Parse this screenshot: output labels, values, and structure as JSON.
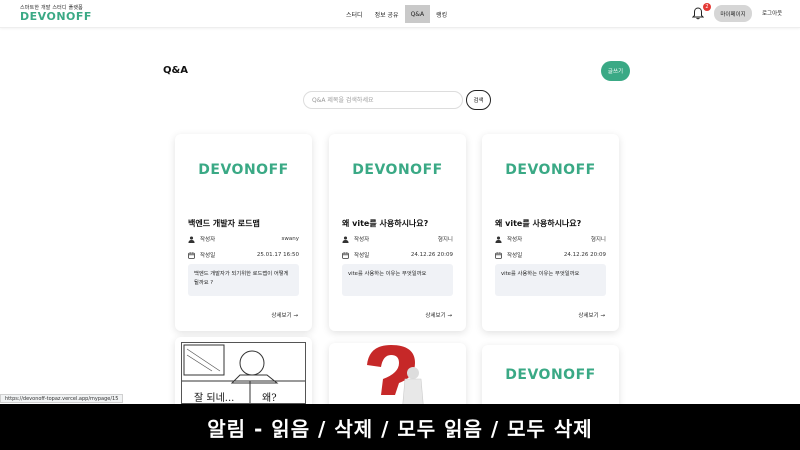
{
  "header": {
    "tagline": "스마트한 개발 스터디 플랫폼",
    "logo": "DEVONOFF",
    "nav": [
      {
        "label": "스터디",
        "active": false
      },
      {
        "label": "정보 공유",
        "active": false
      },
      {
        "label": "Q&A",
        "active": true
      },
      {
        "label": "랭킹",
        "active": false
      }
    ],
    "notification_count": "2",
    "mypage_label": "마이페이지",
    "logout_label": "로그아웃"
  },
  "main": {
    "title": "Q&A",
    "write_label": "글쓰기",
    "search_placeholder": "Q&A 제목을 검색하세요",
    "search_button": "검색"
  },
  "cards": [
    {
      "logo": "DEVONOFF",
      "title": "백엔드 개발자 로드맵",
      "author_label": "작성자",
      "author": "swany",
      "date_label": "작성일",
      "date": "25.01.17 16:50",
      "body": "백엔드 개발자가 되기위한 로드맵이 어떻게 될까요 ?",
      "more": "상세보기 →"
    },
    {
      "logo": "DEVONOFF",
      "title": "왜 vite를 사용하시나요?",
      "author_label": "작성자",
      "author": "형지니",
      "date_label": "작성일",
      "date": "24.12.26 20:09",
      "body": "vite를 사용하는 이유는 무엇일까요",
      "more": "상세보기 →"
    },
    {
      "logo": "DEVONOFF",
      "title": "왜 vite를 사용하시나요?",
      "author_label": "작성자",
      "author": "형지니",
      "date_label": "작성일",
      "date": "24.12.26 20:09",
      "body": "vite를 사용하는 이유는 무엇일까요",
      "more": "상세보기 →"
    }
  ],
  "row2": {
    "meme_text_1": "잘 되네...",
    "meme_text_2": "왜?",
    "logo": "DEVONOFF"
  },
  "status_url": "https://devonoff-topaz.vercel.app/mypage/15",
  "caption": "알림 - 읽음 / 삭제 / 모두 읽음 / 모두 삭제",
  "colors": {
    "brand": "#3aa985",
    "badge": "#e53935",
    "nav_active": "#c9c9c9"
  }
}
